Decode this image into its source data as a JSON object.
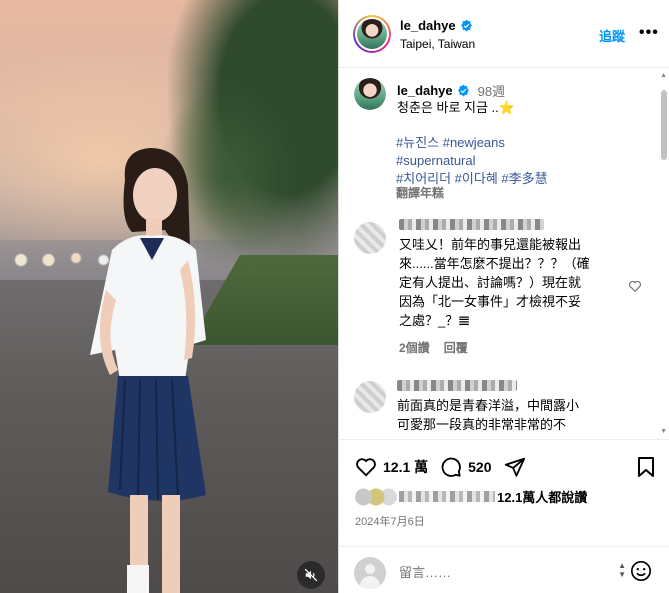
{
  "post": {
    "username": "le_dahye",
    "location": "Taipei, Taiwan",
    "follow_label": "追蹤",
    "more_label": "•••"
  },
  "caption": {
    "username": "le_dahye",
    "time": "98週",
    "text": "청춘은 바로 지금 ..⭐",
    "tags_line1": "#뉴진스 #newjeans",
    "tags_line2": "#supernatural",
    "tags_line3": "#치어리더 #이다혜 #李多慧",
    "translate_label": "翻譯年糕"
  },
  "comments": [
    {
      "text_lines": [
        "又哇乂！前年的事兒還能被報出",
        "來......當年怎麼不提出？？？（確",
        "定有人提出、討論嗎？）現在就",
        "因為「北一女事件」才檢視不妥",
        "之處？_？𝌆"
      ],
      "replies_label": "2個讚",
      "reply_label": "回覆"
    },
    {
      "text_lines": [
        "前面真的是青春洋溢，中間露小",
        "可愛那一段真的非常非常的不"
      ]
    }
  ],
  "actions": {
    "likes_count": "12.1 萬",
    "comments_count": "520",
    "liked_by": "12.1萬人都說讚",
    "date": "2024年7月6日"
  },
  "comment_input": {
    "placeholder": "留言……"
  },
  "colors": {
    "accent": "#0095f6",
    "verified": "#0095f6",
    "muted": "#737373"
  }
}
